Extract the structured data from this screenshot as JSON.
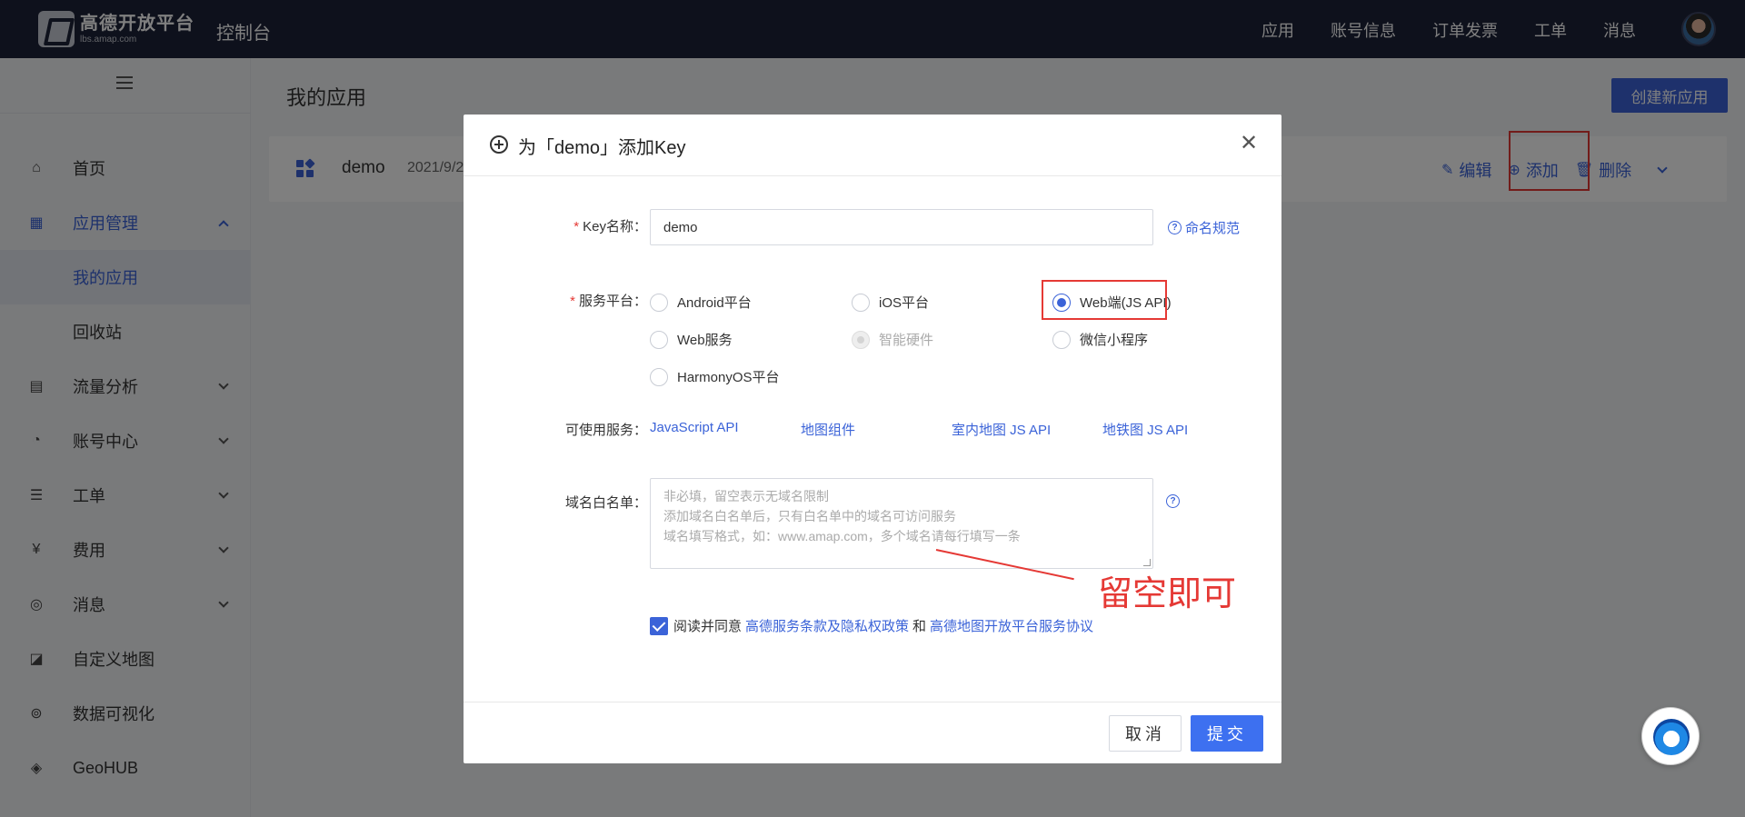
{
  "topbar": {
    "logo_main": "高德开放平台",
    "logo_sub": "lbs.amap.com",
    "console": "控制台",
    "nav": [
      "应用",
      "账号信息",
      "订单发票",
      "工单",
      "消息"
    ]
  },
  "sidebar": {
    "items": [
      {
        "label": "首页",
        "icon": "home-icon"
      },
      {
        "label": "应用管理",
        "icon": "grid-icon"
      },
      {
        "label": "我的应用"
      },
      {
        "label": "回收站"
      },
      {
        "label": "流量分析",
        "icon": "chart-icon"
      },
      {
        "label": "账号中心",
        "icon": "user-icon"
      },
      {
        "label": "工单",
        "icon": "ticket-icon"
      },
      {
        "label": "费用",
        "icon": "fee-icon"
      },
      {
        "label": "消息",
        "icon": "message-icon"
      },
      {
        "label": "自定义地图",
        "icon": "map-icon"
      },
      {
        "label": "数据可视化",
        "icon": "visual-icon"
      },
      {
        "label": "GeoHUB",
        "icon": "layers-icon"
      }
    ]
  },
  "main": {
    "title": "我的应用",
    "create_button": "创建新应用",
    "app": {
      "name": "demo",
      "date": "2021/9/2",
      "actions": {
        "edit": "编辑",
        "add": "添加",
        "delete": "删除"
      }
    }
  },
  "modal": {
    "title": "为「demo」添加Key",
    "key_label": "Key名称：",
    "key_value": "demo",
    "naming_link": "命名规范",
    "platform_label": "服务平台：",
    "platforms": [
      "Android平台",
      "iOS平台",
      "Web端(JS API)",
      "Web服务",
      "智能硬件",
      "微信小程序",
      "HarmonyOS平台"
    ],
    "selected_platform": "Web端(JS API)",
    "services_label": "可使用服务：",
    "services": [
      "JavaScript API",
      "地图组件",
      "室内地图 JS API",
      "地铁图 JS API"
    ],
    "whitelist_label": "域名白名单：",
    "whitelist_placeholder": [
      "非必填，留空表示无域名限制",
      "添加域名白名单后，只有白名单中的域名可访问服务",
      "域名填写格式，如：www.amap.com，多个域名请每行填写一条"
    ],
    "annotation": "留空即可",
    "agree_prefix": "阅读并同意",
    "agree_link1": "高德服务条款及隐私权政策",
    "agree_and": "和",
    "agree_link2": "高德地图开放平台服务协议",
    "cancel": "取消",
    "submit": "提交"
  },
  "colors": {
    "primary": "#3b63d8",
    "annotation": "#e53935",
    "topbar": "#1c2238"
  }
}
